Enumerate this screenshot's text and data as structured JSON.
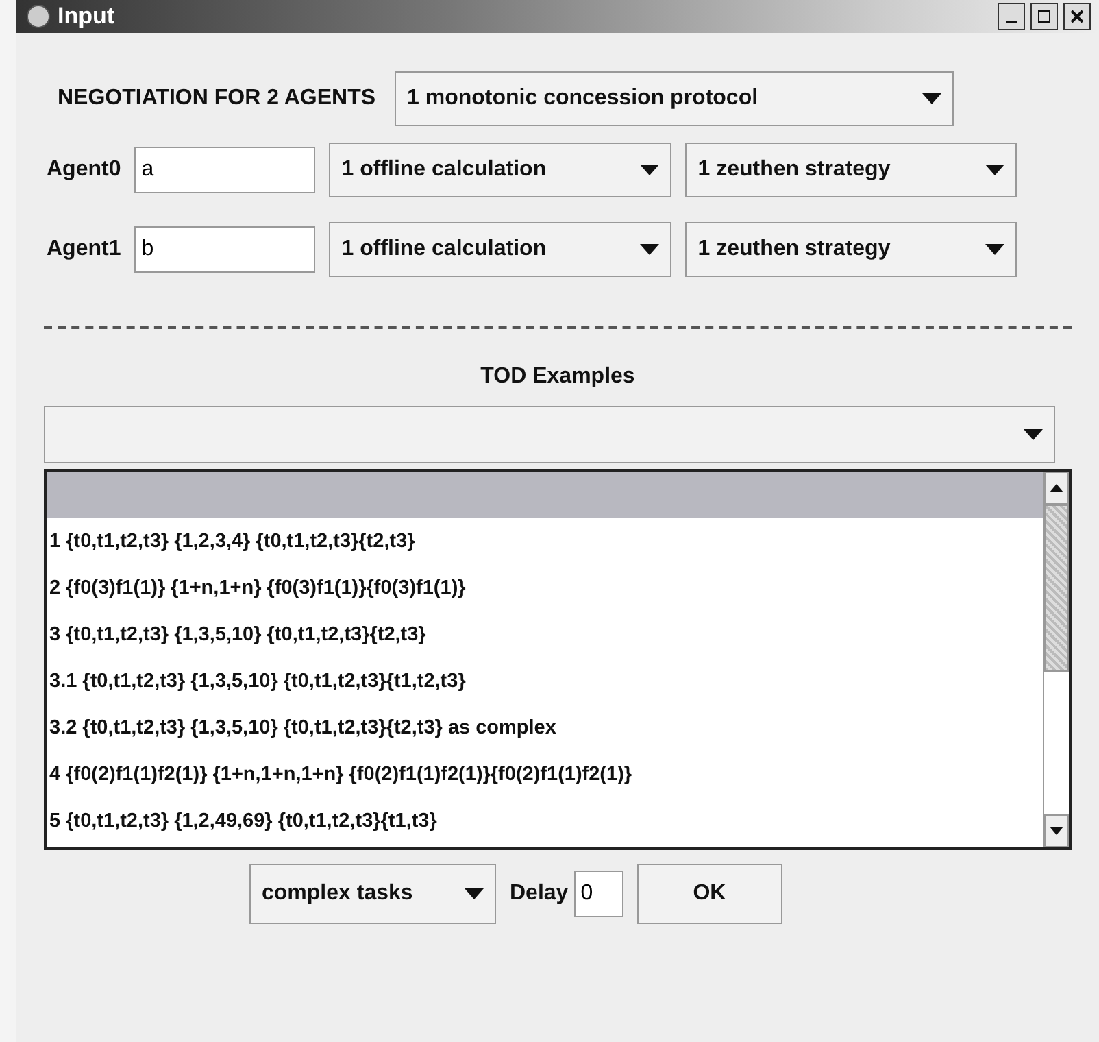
{
  "window": {
    "title": "Input"
  },
  "header": {
    "label": "NEGOTIATION FOR 2 AGENTS",
    "protocol": "1 monotonic concession protocol"
  },
  "agents": [
    {
      "name": "Agent0",
      "value": "a",
      "calculation": "1 offline calculation",
      "strategy": "1 zeuthen strategy"
    },
    {
      "name": "Agent1",
      "value": "b",
      "calculation": "1 offline calculation",
      "strategy": "1 zeuthen strategy"
    }
  ],
  "examples_title": "TOD Examples",
  "examples": [
    {
      "selected": true
    },
    {
      "label": "1 {t0,t1,t2,t3} {1,2,3,4} {t0,t1,t2,t3}{t2,t3}",
      "selected": false
    },
    {
      "label": "2 {f0(3)f1(1)} {1+n,1+n} {f0(3)f1(1)}{f0(3)f1(1)}",
      "selected": false
    },
    {
      "label": "3 {t0,t1,t2,t3} {1,3,5,10} {t0,t1,t2,t3}{t2,t3}",
      "selected": false
    },
    {
      "label": "3.1 {t0,t1,t2,t3} {1,3,5,10} {t0,t1,t2,t3}{t1,t2,t3}",
      "selected": false
    },
    {
      "label": "3.2 {t0,t1,t2,t3} {1,3,5,10} {t0,t1,t2,t3}{t2,t3} as complex",
      "selected": false
    },
    {
      "label": "4 {f0(2)f1(1)f2(1)} {1+n,1+n,1+n} {f0(2)f1(1)f2(1)}{f0(2)f1(1)f2(1)}",
      "selected": false
    },
    {
      "label": "5 {t0,t1,t2,t3} {1,2,49,69} {t0,t1,t2,t3}{t1,t3}",
      "selected": false
    }
  ],
  "footer": {
    "task_type": "complex tasks",
    "delay_label": "Delay",
    "delay_value": "0",
    "ok": "OK"
  }
}
